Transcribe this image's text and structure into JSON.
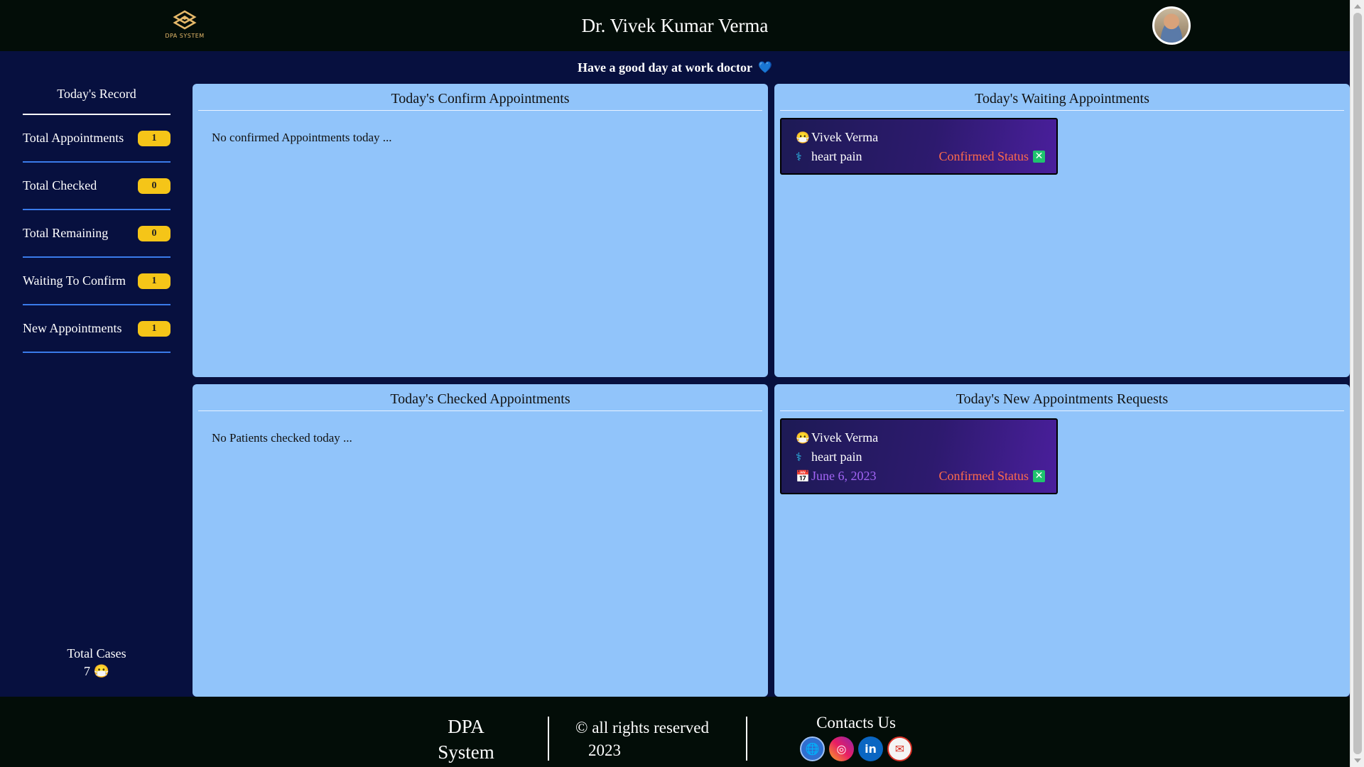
{
  "header": {
    "logo_text": "DPA SYSTEM",
    "doctor_name": "Dr. Vivek Kumar Verma"
  },
  "greeting": {
    "text": "Have a good day at work doctor",
    "emoji": "💙"
  },
  "sidebar": {
    "title": "Today's Record",
    "stats": [
      {
        "label": "Total Appointments",
        "value": "1"
      },
      {
        "label": "Total Checked",
        "value": "0"
      },
      {
        "label": "Total Remaining",
        "value": "0"
      },
      {
        "label": "Waiting To Confirm",
        "value": "1"
      },
      {
        "label": "New Appointments",
        "value": "1"
      }
    ],
    "total_cases_label": "Total Cases",
    "total_cases_value": "7",
    "total_cases_emoji": "😷"
  },
  "panels": {
    "confirm": {
      "title": "Today's Confirm Appointments",
      "empty_text": "No confirmed Appointments today ..."
    },
    "waiting": {
      "title": "Today's Waiting Appointments",
      "card": {
        "patient_icon": "😷",
        "patient": "Vivek Verma",
        "issue_icon": "⚕",
        "issue": "heart pain",
        "status": "Confirmed Status",
        "status_icon": "✕"
      }
    },
    "checked": {
      "title": "Today's Checked Appointments",
      "empty_text": "No Patients checked today ..."
    },
    "new_requests": {
      "title": "Today's New Appointments Requests",
      "card": {
        "patient_icon": "😷",
        "patient": "Vivek Verma",
        "issue_icon": "⚕",
        "issue": "heart pain",
        "date_icon": "📅",
        "date": "June 6, 2023",
        "status": "Confirmed Status",
        "status_icon": "✕"
      }
    }
  },
  "footer": {
    "brand_line1": "DPA",
    "brand_line2": "System",
    "rights": "© all rights reserved",
    "year": "2023",
    "contacts_label": "Contacts Us",
    "social": [
      {
        "name": "globe-icon",
        "glyph": "🌐"
      },
      {
        "name": "instagram-icon",
        "glyph": "◎"
      },
      {
        "name": "linkedin-icon",
        "glyph": "in"
      },
      {
        "name": "mail-icon",
        "glyph": "✉"
      }
    ]
  },
  "colors": {
    "page_bg": "#07103f",
    "header_bg": "#030d08",
    "panel_bg": "#91c4fa",
    "badge_bg": "#f5c518",
    "status_text": "#ff6b4a",
    "date_text": "#a265f5"
  }
}
